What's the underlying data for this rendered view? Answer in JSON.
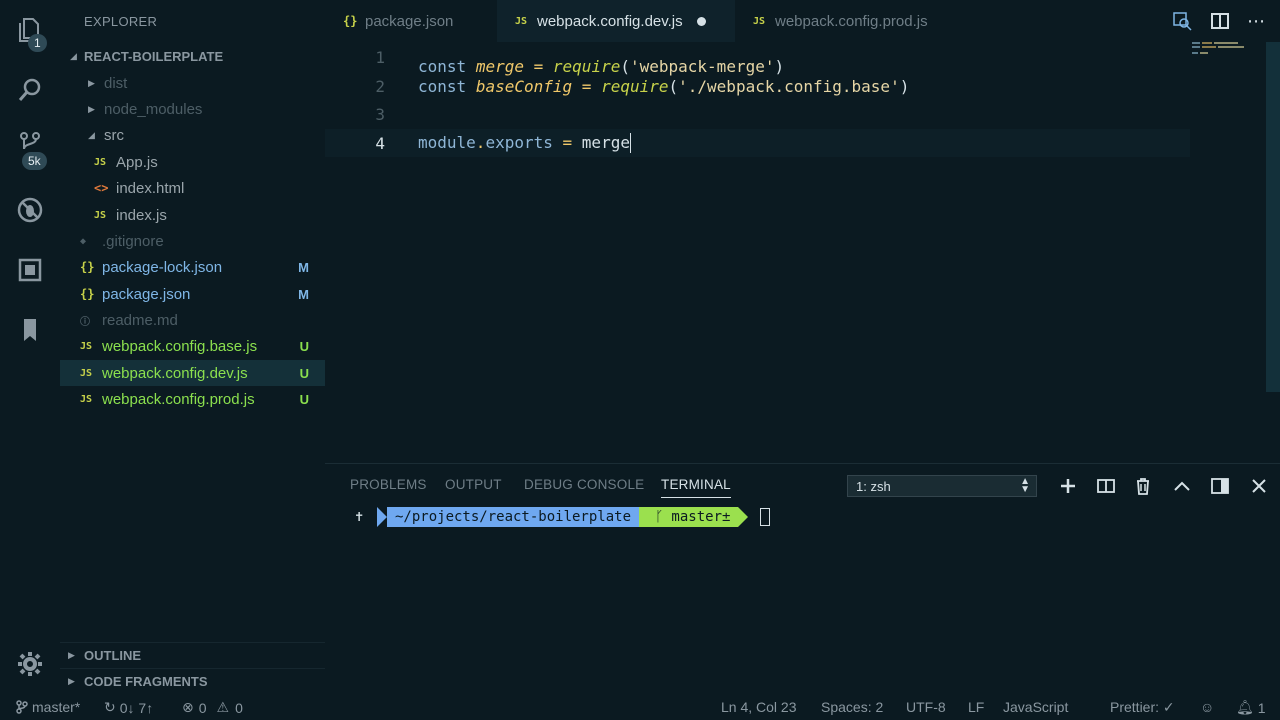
{
  "activity_bar": {
    "explorer_badge": "1",
    "scm_badge": "5k"
  },
  "sidebar": {
    "title": "EXPLORER",
    "root": "REACT-BOILERPLATE",
    "items": [
      {
        "label": "dist",
        "type": "folder"
      },
      {
        "label": "node_modules",
        "type": "folder"
      },
      {
        "label": "src",
        "type": "folder-open"
      },
      {
        "label": "App.js",
        "icon": "JS"
      },
      {
        "label": "index.html",
        "icon": "<>"
      },
      {
        "label": "index.js",
        "icon": "JS"
      },
      {
        "label": ".gitignore",
        "icon": "◆"
      },
      {
        "label": "package-lock.json",
        "icon": "{}",
        "git": "M"
      },
      {
        "label": "package.json",
        "icon": "{}",
        "git": "M"
      },
      {
        "label": "readme.md",
        "icon": "ⓘ"
      },
      {
        "label": "webpack.config.base.js",
        "icon": "JS",
        "git": "U"
      },
      {
        "label": "webpack.config.dev.js",
        "icon": "JS",
        "git": "U"
      },
      {
        "label": "webpack.config.prod.js",
        "icon": "JS",
        "git": "U"
      }
    ],
    "sections": [
      "OUTLINE",
      "CODE FRAGMENTS"
    ]
  },
  "tabs": [
    {
      "label": "package.json",
      "icon": "{}"
    },
    {
      "label": "webpack.config.dev.js",
      "icon": "JS"
    },
    {
      "label": "webpack.config.prod.js",
      "icon": "JS"
    }
  ],
  "editor": {
    "line_numbers": [
      "1",
      "2",
      "3",
      "4"
    ],
    "l1": {
      "kw": "const",
      "var": "merge",
      "eq": "=",
      "fn": "require",
      "open": "(",
      "str": "'webpack-merge'",
      "close": ")"
    },
    "l2": {
      "kw": "const",
      "var": "baseConfig",
      "eq": "=",
      "fn": "require",
      "open": "(",
      "str": "'./webpack.config.base'",
      "close": ")"
    },
    "l4": {
      "obj": "module",
      "dot": ".",
      "prop": "exports",
      "eq": "=",
      "rest": "merge"
    }
  },
  "panel": {
    "tabs": [
      "PROBLEMS",
      "OUTPUT",
      "DEBUG CONSOLE",
      "TERMINAL"
    ],
    "terminal_select": "1: zsh",
    "prompt_symbol": "✝",
    "path": "~/projects/react-boilerplate",
    "branch": "master±",
    "branch_icon": "ᚴ"
  },
  "status": {
    "branch": "master*",
    "sync": "0↓ 7↑",
    "errors": "0",
    "warnings": "0",
    "position": "Ln 4, Col 23",
    "spaces": "Spaces: 2",
    "encoding": "UTF-8",
    "eol": "LF",
    "language": "JavaScript",
    "prettier": "Prettier: ✓",
    "notifications": "1"
  }
}
